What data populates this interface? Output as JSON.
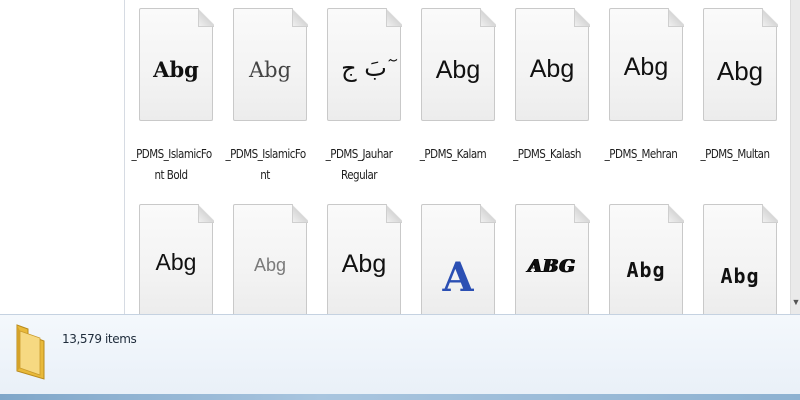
{
  "files_row1": [
    {
      "sample": "Abg",
      "name": "_PDMS_IslamicFo nt Bold",
      "line1": "_PDMS_IslamicFo",
      "line2": "nt Bold"
    },
    {
      "sample": "Abg",
      "name": "_PDMS_IslamicFo nt",
      "line1": "_PDMS_IslamicFo",
      "line2": "nt"
    },
    {
      "sample": "ٓبَ ج",
      "name": "_PDMS_Jauhar Regular",
      "line1": "_PDMS_Jauhar",
      "line2": "Regular"
    },
    {
      "sample": "Abg",
      "name": "_PDMS_Kalam",
      "line1": "_PDMS_Kalam",
      "line2": ""
    },
    {
      "sample": "Abg",
      "name": "_PDMS_Kalash",
      "line1": "_PDMS_Kalash",
      "line2": ""
    },
    {
      "sample": "Abg",
      "name": "_PDMS_Mehran",
      "line1": "_PDMS_Mehran",
      "line2": ""
    },
    {
      "sample": "Abg",
      "name": "_PDMS_Multan",
      "line1": "_PDMS_Multan",
      "line2": ""
    }
  ],
  "files_row2": [
    {
      "sample": "Abg"
    },
    {
      "sample": "Abg"
    },
    {
      "sample": "Abg"
    },
    {
      "sample": "A"
    },
    {
      "sample": "ABG"
    },
    {
      "sample": "Abg"
    },
    {
      "sample": "Abg"
    }
  ],
  "status": {
    "item_count": "13,579 items"
  },
  "icons": {
    "folder": "folder-icon",
    "font_file": "font-file-icon",
    "scroll_down": "scroll-down-arrow-icon"
  },
  "colors": {
    "details_bg": "#eef3fa",
    "folder": "#e8b93a",
    "accent_blue": "#2b4fb3"
  }
}
